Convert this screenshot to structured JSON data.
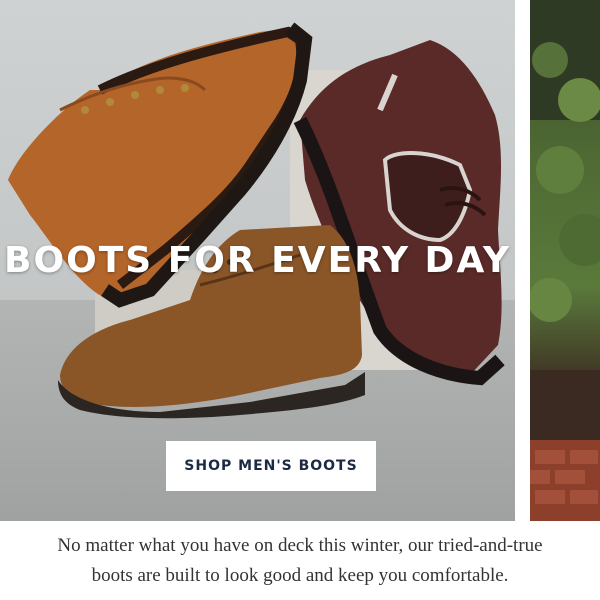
{
  "hero": {
    "headline": "BOOTS FOR EVERY DAY",
    "cta_label": "SHOP MEN'S BOOTS",
    "image_description": ""
  },
  "body_copy": {
    "line1": "No matter what you have on deck this winter, our tried-and-true",
    "line2": "boots are built to look good and keep you comfortable."
  },
  "colors": {
    "cta_text": "#1c2a44",
    "headline_text": "#ffffff",
    "body_text": "#333333",
    "background": "#ffffff"
  }
}
